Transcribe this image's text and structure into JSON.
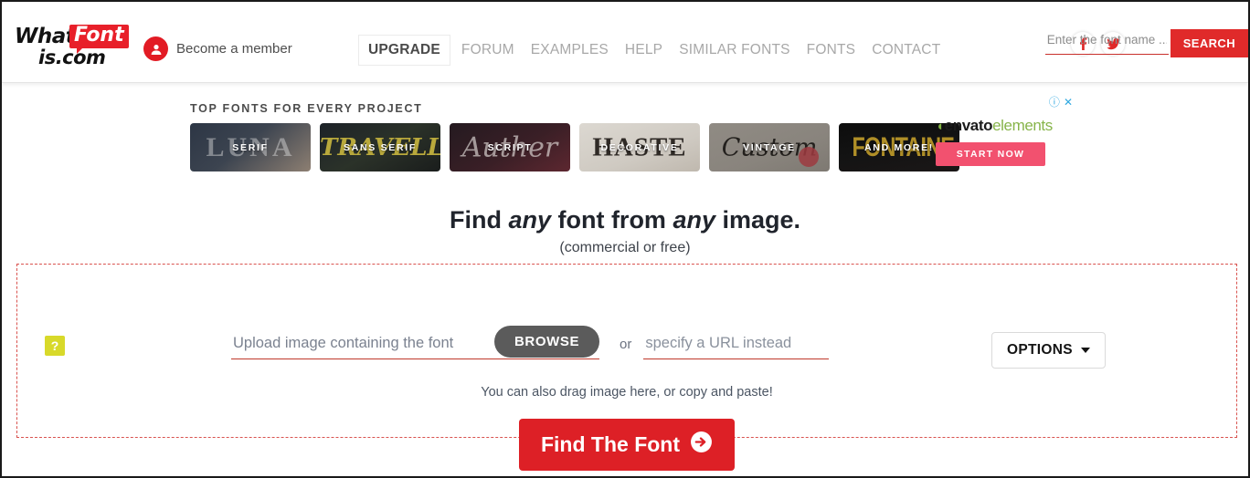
{
  "header": {
    "logo": {
      "part1": "What",
      "bubble": "Font",
      "part2": "is.com"
    },
    "member": {
      "label": "Become a member",
      "icon": "user-circle-icon"
    },
    "nav": [
      {
        "label": "UPGRADE",
        "primary": true
      },
      {
        "label": "FORUM",
        "primary": false
      },
      {
        "label": "EXAMPLES",
        "primary": false
      },
      {
        "label": "HELP",
        "primary": false
      },
      {
        "label": "SIMILAR FONTS",
        "primary": false
      },
      {
        "label": "FONTS",
        "primary": false
      },
      {
        "label": "CONTACT",
        "primary": false
      }
    ],
    "social": [
      {
        "name": "facebook-icon"
      },
      {
        "name": "twitter-icon"
      }
    ],
    "search": {
      "placeholder": "Enter the font name ...",
      "value": "",
      "button_label": "SEARCH"
    }
  },
  "top_fonts": {
    "title": "TOP FONTS FOR EVERY PROJECT",
    "cards": [
      {
        "label": "SERIF",
        "ghost": "LUNA"
      },
      {
        "label": "SANS SERIF",
        "ghost": "TRAVELLER"
      },
      {
        "label": "SCRIPT",
        "ghost": "Auther"
      },
      {
        "label": "DECORATIVE",
        "ghost": "HASTE"
      },
      {
        "label": "VINTAGE",
        "ghost": "Custom"
      },
      {
        "label": "AND MORE!",
        "ghost": "FONTAINE"
      }
    ]
  },
  "ad": {
    "info_icon": "info-circle-icon",
    "close_icon": "close-icon",
    "brand_leaf": "◖",
    "brand_first": "envato",
    "brand_second": "elements",
    "button_label": "START NOW"
  },
  "hero": {
    "title_part1": "Find ",
    "title_em1": "any",
    "title_part2": " font from ",
    "title_em2": "any",
    "title_part3": " image.",
    "subtitle": "(commercial or free)"
  },
  "dropzone": {
    "help_badge": "?",
    "upload_placeholder": "Upload image containing the font",
    "browse_label": "BROWSE",
    "or_label": "or",
    "url_placeholder": "specify a URL instead",
    "url_value": "",
    "options_label": "OPTIONS",
    "hint": "You can also drag image here, or copy and paste!",
    "find_label": "Find The Font",
    "find_icon": "arrow-right-circle-icon"
  },
  "colors": {
    "brand_red": "#e8202a",
    "cta_red": "#dd2026",
    "search_red": "#e02a2a",
    "dashed_border": "#d9534f",
    "help_yellow": "#d8d92a",
    "ad_pink": "#f2516f",
    "ad_green": "#87b44a",
    "ad_blue": "#2fa8e0",
    "browse_gray": "#5b5b5b"
  }
}
